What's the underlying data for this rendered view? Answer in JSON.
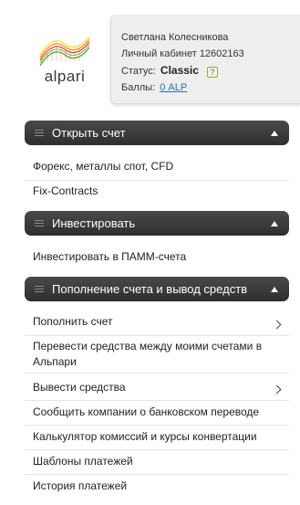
{
  "logo": {
    "word": "alpari"
  },
  "profile": {
    "name": "Светлана Колесникова",
    "cabinet": "Личный кабинет 12602163",
    "status_label": "Статус:",
    "status_value": "Classic",
    "help_badge": "?",
    "points_label": "Баллы:",
    "points_value": "0 ALP"
  },
  "sections": [
    {
      "title": "Открыть счет",
      "items": [
        "Форекс, металлы спот, CFD",
        "Fix-Contracts"
      ]
    },
    {
      "title": "Инвестировать",
      "items": [
        "Инвестировать в ПАММ-счета"
      ]
    },
    {
      "title": "Пополнение счета и вывод средств",
      "items": [
        "Пополнить счет",
        "Перевести средства между моими счетами в Альпари",
        "Вывести средства",
        "Сообщить компании о банковском переводе",
        "Калькулятор комиссий и курсы конвертации",
        "Шаблоны платежей",
        "История платежей"
      ]
    }
  ],
  "icons": {
    "section_handle": "drag-handle-icon",
    "collapse": "caret-up-icon",
    "submenu": "chevron-right-icon"
  },
  "colors": {
    "bar_bg": "#3a3a3a",
    "link": "#2a6ebb",
    "badge": "#8cb33a",
    "card_bg": "#eeeeee"
  }
}
